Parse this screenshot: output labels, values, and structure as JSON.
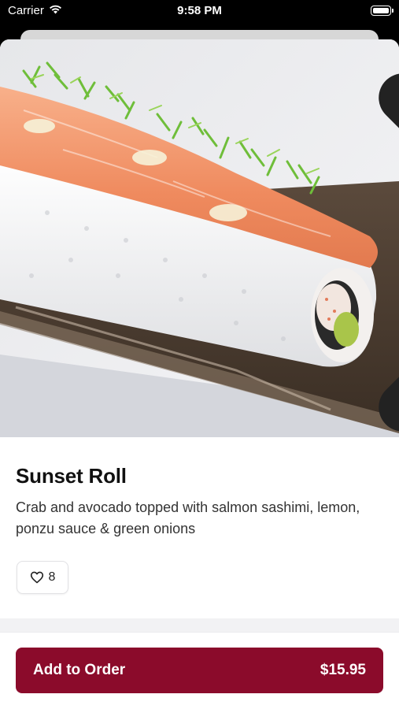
{
  "status_bar": {
    "carrier": "Carrier",
    "time": "9:58 PM"
  },
  "icons": {
    "wifi": "wifi-icon",
    "battery": "battery-icon",
    "close": "close-icon",
    "heart": "heart-outline-icon"
  },
  "item": {
    "title": "Sunset Roll",
    "description": "Crab and avocado topped with salmon sashimi, lemon, ponzu sauce & green onions",
    "likes": "8"
  },
  "order_button": {
    "label": "Add to Order",
    "price": "$15.95"
  },
  "colors": {
    "accent": "#8b0b2b",
    "background_sheet": "#f2f2f4",
    "text_primary": "#111111"
  }
}
